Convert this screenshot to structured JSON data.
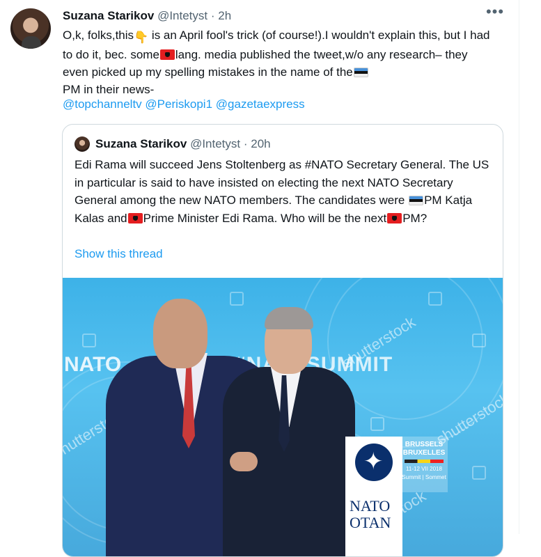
{
  "tweet": {
    "author_name": "Suzana Starikov",
    "author_handle": "@Intetyst",
    "separator": "·",
    "time": "2h",
    "more_label": "•••",
    "text_parts": {
      "p1": "O,k, folks,this",
      "p2": " is an April fool's trick (of course!).I wouldn't explain this, but I had to do it, bec. some",
      "p3": "lang. media published the tweet,w/o any research– they even picked up my spelling mistakes in the name of the",
      "p4": "PM in their news-"
    },
    "mentions": [
      "@topchanneltv",
      "@Periskopi1",
      "@gazetaexpress"
    ],
    "emoji_pointing": "👇"
  },
  "quoted_tweet": {
    "author_name": "Suzana Starikov",
    "author_handle": "@Intetyst",
    "separator": "·",
    "time": "20h",
    "text_parts": {
      "p1": "Edi Rama will succeed Jens Stoltenberg as #NATO Secretary General. The US in particular is said to have insisted on electing the next NATO Secretary General among the new NATO members. The candidates were ",
      "p2": "PM Katja Kalas and",
      "p3": "Prime Minister Edi Rama. Who will be the next",
      "p4": "PM?"
    },
    "show_thread": "Show this thread",
    "image": {
      "left_sign": "NATO",
      "backdrop": "#NATOSUMMIT",
      "watermark": "shutterstock",
      "podium_label": "NATO\nOTAN",
      "city_sign_1": "BRUSSELS",
      "city_sign_2": "BRUXELLES",
      "city_sign_3": "11-12 VII 2018",
      "city_sign_4": "Summit | Sommet"
    }
  },
  "colors": {
    "link": "#1d9bf0",
    "secondary_text": "#536471",
    "border": "#cfd9de",
    "flag_albania": "#e41e20",
    "flag_estonia_blue": "#4891d9"
  },
  "icons": [
    "more-icon",
    "albania-flag-icon",
    "estonia-flag-icon",
    "pointing-down-emoji"
  ]
}
